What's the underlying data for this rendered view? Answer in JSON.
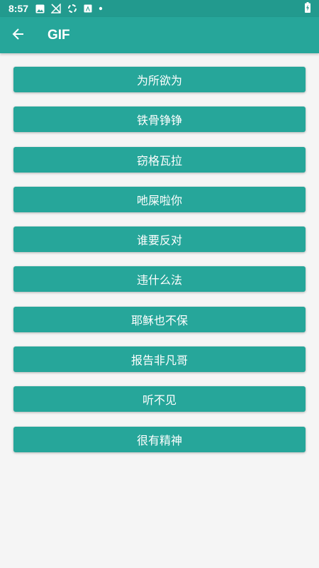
{
  "status_bar": {
    "time": "8:57",
    "icons": [
      "image-icon",
      "no-signal-icon",
      "sync-icon",
      "a-letter-icon",
      "dot-icon",
      "battery-charging-icon"
    ],
    "color": "#229a8e"
  },
  "app_bar": {
    "title": "GIF",
    "back_icon": "arrow-back-icon",
    "color": "#26a69a"
  },
  "buttons": [
    {
      "label": "为所欲为"
    },
    {
      "label": "铁骨铮铮"
    },
    {
      "label": "窃格瓦拉"
    },
    {
      "label": "吔屎啦你"
    },
    {
      "label": "谁要反对"
    },
    {
      "label": "违什么法"
    },
    {
      "label": "耶稣也不保"
    },
    {
      "label": "报告非凡哥"
    },
    {
      "label": "听不见"
    },
    {
      "label": "很有精神"
    }
  ],
  "theme": {
    "button_color": "#26a69a",
    "background": "#f5f5f5",
    "text_color": "#ffffff"
  }
}
